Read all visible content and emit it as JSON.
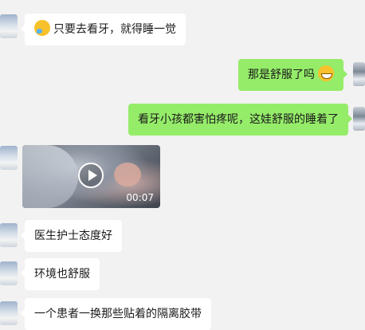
{
  "messages": [
    {
      "side": "in",
      "text": "只要去看牙，就得睡一觉",
      "emoji": "sleepy-emoji"
    },
    {
      "side": "out",
      "text": "那是舒服了吗",
      "emoji": "grin-emoji"
    },
    {
      "side": "out",
      "text": "看牙小孩都害怕疼呢，这娃舒服的睡着了"
    },
    {
      "side": "in",
      "type": "video",
      "duration": "00:07"
    },
    {
      "side": "in",
      "text": "医生护士态度好"
    },
    {
      "side": "in",
      "text": "环境也舒服"
    },
    {
      "side": "in",
      "text": "一个患者一换那些贴着的隔离胶带"
    }
  ],
  "colors": {
    "background": "#f2f2f2",
    "incoming": "#ffffff",
    "outgoing": "#95ec69"
  }
}
